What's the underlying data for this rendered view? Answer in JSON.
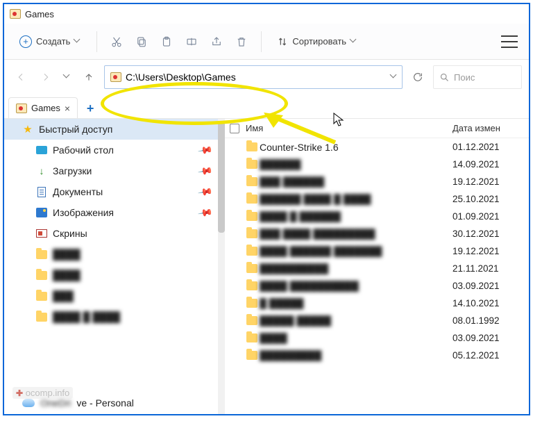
{
  "title": "Games",
  "toolbar": {
    "new_label": "Создать",
    "sort_label": "Сортировать"
  },
  "address": {
    "path": "C:\\Users\\Desktop\\Games"
  },
  "search": {
    "placeholder": "Поис"
  },
  "tab": {
    "label": "Games"
  },
  "sidebar": {
    "items": [
      {
        "label": "Быстрый доступ",
        "kind": "star",
        "selected": true,
        "pinned": false,
        "level": 1,
        "blurred": false
      },
      {
        "label": "Рабочий стол",
        "kind": "desktop",
        "selected": false,
        "pinned": true,
        "level": 2,
        "blurred": false
      },
      {
        "label": "Загрузки",
        "kind": "download",
        "selected": false,
        "pinned": true,
        "level": 2,
        "blurred": false
      },
      {
        "label": "Документы",
        "kind": "doc",
        "selected": false,
        "pinned": true,
        "level": 2,
        "blurred": false
      },
      {
        "label": "Изображения",
        "kind": "img",
        "selected": false,
        "pinned": true,
        "level": 2,
        "blurred": false
      },
      {
        "label": "Скрины",
        "kind": "screen",
        "selected": false,
        "pinned": false,
        "level": 2,
        "blurred": false
      },
      {
        "label": "████",
        "kind": "folder",
        "selected": false,
        "pinned": false,
        "level": 2,
        "blurred": true
      },
      {
        "label": "████",
        "kind": "folder",
        "selected": false,
        "pinned": false,
        "level": 2,
        "blurred": true
      },
      {
        "label": "███",
        "kind": "folder",
        "selected": false,
        "pinned": false,
        "level": 2,
        "blurred": true
      },
      {
        "label": "████ █ ████",
        "kind": "folder",
        "selected": false,
        "pinned": false,
        "level": 2,
        "blurred": true
      }
    ],
    "onedrive": "ve - Personal",
    "onedrive_prefix": ""
  },
  "columns": {
    "name": "Имя",
    "date": "Дата измен"
  },
  "files": [
    {
      "name": "Counter-Strike 1.6",
      "date": "01.12.2021",
      "blurred_name": false
    },
    {
      "name": "██████",
      "date": "14.09.2021",
      "blurred_name": true
    },
    {
      "name": "███ ██████",
      "date": "19.12.2021",
      "blurred_name": true
    },
    {
      "name": "██████ ████ █ ████",
      "date": "25.10.2021",
      "blurred_name": true
    },
    {
      "name": "████ █ ██████",
      "date": "01.09.2021",
      "blurred_name": true
    },
    {
      "name": "███ ████ █████████",
      "date": "30.12.2021",
      "blurred_name": true
    },
    {
      "name": "████ ██████ ███████",
      "date": "19.12.2021",
      "blurred_name": true
    },
    {
      "name": "██████████",
      "date": "21.11.2021",
      "blurred_name": true
    },
    {
      "name": "████ ██████████",
      "date": "03.09.2021",
      "blurred_name": true
    },
    {
      "name": "█ █████",
      "date": "14.10.2021",
      "blurred_name": true
    },
    {
      "name": "█████ █████",
      "date": "08.01.1992",
      "blurred_name": true
    },
    {
      "name": "████",
      "date": "03.09.2021",
      "blurred_name": true
    },
    {
      "name": "█████████",
      "date": "05.12.2021",
      "blurred_name": true
    }
  ],
  "watermark": "ocomp.info"
}
